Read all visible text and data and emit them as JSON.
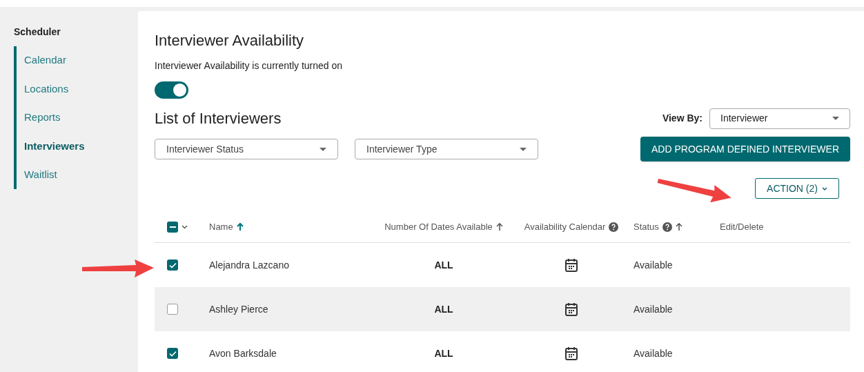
{
  "sidebar": {
    "title": "Scheduler",
    "items": [
      {
        "label": "Calendar",
        "selected": false
      },
      {
        "label": "Locations",
        "selected": false
      },
      {
        "label": "Reports",
        "selected": false
      },
      {
        "label": "Interviewers",
        "selected": true
      },
      {
        "label": "Waitlist",
        "selected": false
      }
    ]
  },
  "section": {
    "title": "Interviewer Availability",
    "description": "Interviewer Availability is currently turned on",
    "toggle_on": true
  },
  "list": {
    "title": "List of Interviewers",
    "view_by_label": "View By:",
    "view_by_value": "Interviewer",
    "filters": [
      "Interviewer Status",
      "Interviewer Type"
    ],
    "add_button": "ADD PROGRAM DEFINED INTERVIEWER",
    "action_button": "ACTION (2)"
  },
  "table": {
    "select_all_indeterminate": true,
    "columns": [
      {
        "label": "Name",
        "sortable": true,
        "sort_active": true,
        "help": false
      },
      {
        "label": "Number Of Dates Available",
        "sortable": true,
        "sort_active": false,
        "help": false
      },
      {
        "label": "Availability Calendar",
        "sortable": false,
        "help": true
      },
      {
        "label": "Status",
        "sortable": true,
        "sort_active": false,
        "help": true
      },
      {
        "label": "Edit/Delete",
        "sortable": false,
        "help": false
      }
    ],
    "rows": [
      {
        "name": "Alejandra Lazcano",
        "dates": "ALL",
        "status": "Available",
        "checked": true
      },
      {
        "name": "Ashley Pierce",
        "dates": "ALL",
        "status": "Available",
        "checked": false
      },
      {
        "name": "Avon Barksdale",
        "dates": "ALL",
        "status": "Available",
        "checked": true
      }
    ]
  }
}
